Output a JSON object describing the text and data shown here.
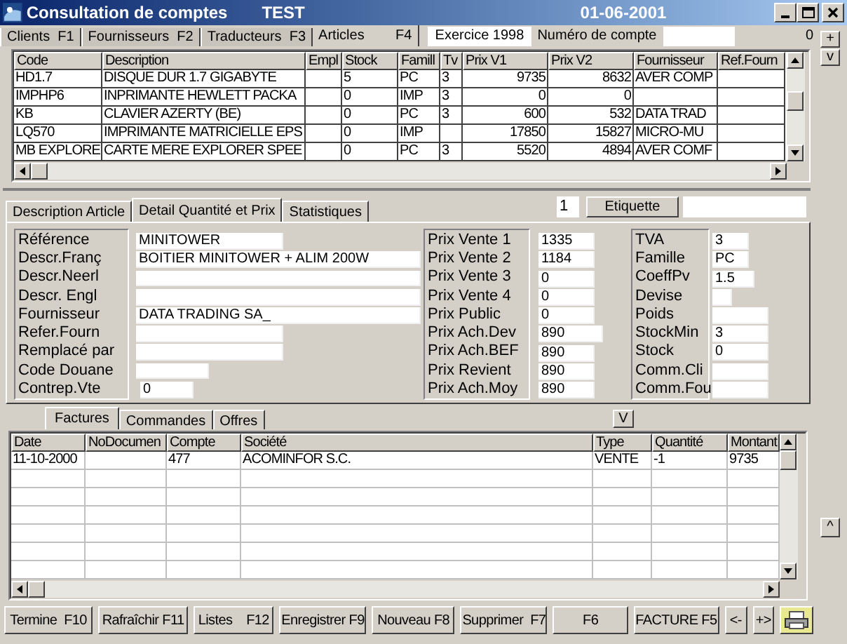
{
  "window": {
    "title": "Consultation de comptes",
    "company": "TEST",
    "date": "01-06-2001"
  },
  "main_tabs": [
    {
      "label": "Clients  F1",
      "selected": false
    },
    {
      "label": "Fournisseurs  F2",
      "selected": false
    },
    {
      "label": "Traducteurs  F3",
      "selected": false
    },
    {
      "label": "Articles        F4",
      "selected": true
    }
  ],
  "header_info": {
    "exercice": "Exercice 1998",
    "account_label": "Numéro de compte",
    "count": "0"
  },
  "side_buttons": [
    "+",
    "v"
  ],
  "articles_table": {
    "columns": [
      "Code",
      "Description",
      "Empl",
      "Stock",
      "Famill",
      "Tv",
      "Prix V1",
      "Prix V2",
      "Fournisseur",
      "Ref.Fourn"
    ],
    "rows": [
      [
        "HD1.7",
        "DISQUE DUR 1.7 GIGABYTE",
        "",
        "5",
        "PC",
        "3",
        "9735",
        "8632",
        "AVER COMP",
        ""
      ],
      [
        "IMPHP6",
        "INPRIMANTE HEWLETT PACKA",
        "",
        "0",
        "IMP",
        "3",
        "0",
        "0",
        "",
        ""
      ],
      [
        "KB",
        "CLAVIER AZERTY (BE)",
        "",
        "0",
        "PC",
        "3",
        "600",
        "532",
        "DATA TRAD",
        ""
      ],
      [
        "LQ570",
        "IMPRIMANTE MATRICIELLE EPS",
        "",
        "0",
        "IMP",
        "",
        "17850",
        "15827",
        "MICRO-MU",
        ""
      ],
      [
        "MB EXPLORE",
        "CARTE MERE EXPLORER SPEE",
        "",
        "0",
        "PC",
        "3",
        "5520",
        "4894",
        "AVER COMF",
        ""
      ]
    ]
  },
  "detail_tabs": [
    {
      "label": "Description Article",
      "selected": false
    },
    {
      "label": "Detail Quantité et Prix",
      "selected": true
    },
    {
      "label": "Statistiques",
      "selected": false
    }
  ],
  "label_count": "1",
  "label_button": "Etiquette",
  "detail_groups": [
    {
      "fields": [
        {
          "label": "Référence",
          "value": "MINITOWER"
        },
        {
          "label": "Descr.Franç",
          "value": "BOITIER MINITOWER + ALIM 200W"
        },
        {
          "label": "Descr.Neerl"
        },
        {
          "label": "Descr. Engl"
        },
        {
          "label": "Fournisseur",
          "value": "DATA TRADING SA_"
        },
        {
          "label": "Refer.Fourn"
        },
        {
          "label": "Remplacé par"
        },
        {
          "label": "Code Douane"
        },
        {
          "label": "Contrep.Vte",
          "value": "0"
        }
      ]
    },
    {
      "fields": [
        {
          "label": "Prix Vente 1",
          "value": "1335"
        },
        {
          "label": "Prix Vente 2",
          "value": "1184"
        },
        {
          "label": "Prix Vente 3",
          "value": "0"
        },
        {
          "label": "Prix Vente 4",
          "value": "0"
        },
        {
          "label": "Prix Public",
          "value": "0"
        },
        {
          "label": "Prix Ach.Dev",
          "value": "890"
        },
        {
          "label": "Prix Ach.BEF",
          "value": "890"
        },
        {
          "label": "Prix Revient",
          "value": "890"
        },
        {
          "label": "Prix Ach.Moy",
          "value": "890"
        }
      ]
    },
    {
      "fields": [
        {
          "label": "TVA",
          "value": "3"
        },
        {
          "label": "Famille",
          "value": "PC"
        },
        {
          "label": "CoeffPv",
          "value": "1.5"
        },
        {
          "label": "Devise"
        },
        {
          "label": "Poids"
        },
        {
          "label": "StockMin",
          "value": "3"
        },
        {
          "label": "Stock",
          "value": "0"
        },
        {
          "label": "Comm.Cli"
        },
        {
          "label": "Comm.Fou"
        }
      ]
    }
  ],
  "document_tabs": [
    {
      "label": "Factures",
      "selected": true
    },
    {
      "label": "Commandes",
      "selected": false
    },
    {
      "label": "Offres",
      "selected": false
    }
  ],
  "expand_button": "V",
  "documents_table": {
    "columns": [
      "Date",
      "NoDocumen",
      "Compte",
      "Société",
      "Type",
      "Quantité",
      "Montant"
    ],
    "rows": [
      [
        "11-10-2000",
        "",
        "477",
        "ACOMINFOR  S.C.",
        "VENTE",
        "-1",
        "9735"
      ]
    ]
  },
  "side_up_button": "^",
  "buttons": [
    "Termine  F10",
    "Rafraîchir F11",
    "Listes    F12",
    "Enregistrer F9",
    "Nouveau F8",
    "Supprimer  F7",
    "F6",
    "FACTURE F5",
    "<-",
    "+>"
  ]
}
